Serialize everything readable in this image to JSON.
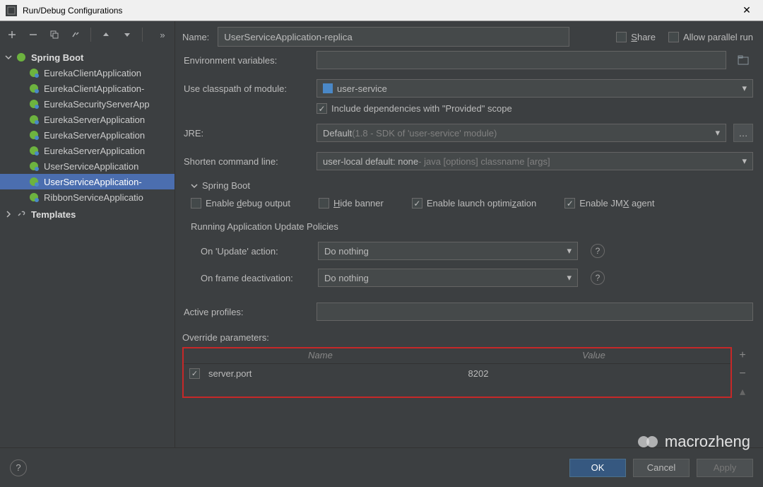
{
  "window": {
    "title": "Run/Debug Configurations"
  },
  "tree": {
    "root": "Spring Boot",
    "items": [
      "EurekaClientApplication",
      "EurekaClientApplication-",
      "EurekaSecurityServerApp",
      "EurekaServerApplication",
      "EurekaServerApplication",
      "EurekaServerApplication",
      "UserServiceApplication",
      "UserServiceApplication-",
      "RibbonServiceApplicatio"
    ],
    "selectedIndex": 7,
    "templates": "Templates"
  },
  "top": {
    "nameLabel": "Name:",
    "nameValue": "UserServiceApplication-replica",
    "share": "Share",
    "allowParallel": "Allow parallel run"
  },
  "fields": {
    "envLabel": "Environment variables:",
    "classpathLabel": "Use classpath of module:",
    "classpathValue": "user-service",
    "includeProvided": "Include dependencies with \"Provided\" scope",
    "jreLabel": "JRE:",
    "jrePrefix": "Default ",
    "jreDim": "(1.8 - SDK of 'user-service' module)",
    "shortenLabel": "Shorten command line:",
    "shortenPrefix": "user-local default: none",
    "shortenDim": " - java [options] classname [args]"
  },
  "spring": {
    "sectionTitle": "Spring Boot",
    "enableDebug": "Enable debug output",
    "hideBanner": "Hide banner",
    "enableLaunchOpt": "Enable launch optimization",
    "enableJmx": "Enable JMX agent",
    "runningPolicies": "Running Application Update Policies",
    "onUpdateLabel": "On 'Update' action:",
    "onUpdateValue": "Do nothing",
    "onFrameLabel": "On frame deactivation:",
    "onFrameValue": "Do nothing"
  },
  "profiles": {
    "activeLabel": "Active profiles:",
    "overrideLabel": "Override parameters:",
    "colName": "Name",
    "colValue": "Value",
    "paramName": "server.port",
    "paramValue": "8202"
  },
  "footer": {
    "ok": "OK",
    "cancel": "Cancel",
    "apply": "Apply"
  },
  "watermark": "macrozheng"
}
